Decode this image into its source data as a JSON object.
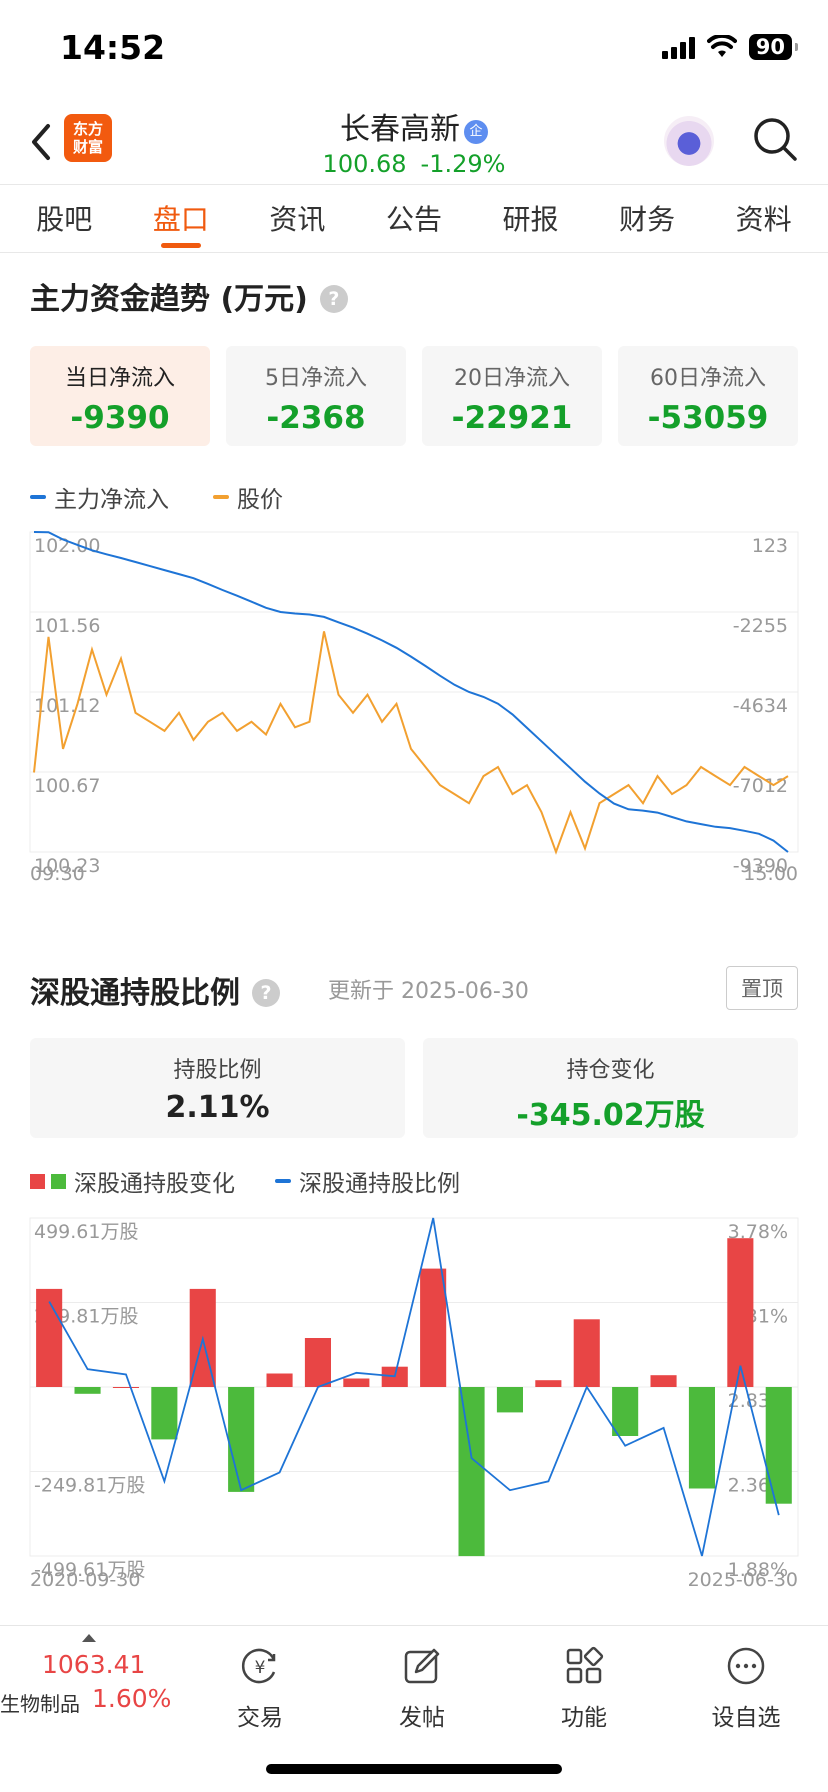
{
  "status": {
    "time": "14:52",
    "battery": "90"
  },
  "header": {
    "logo_line1": "东方",
    "logo_line2": "财富",
    "stock_name": "长春高新",
    "badge": "企",
    "price": "100.68",
    "change": "-1.29%"
  },
  "tabs": [
    "股吧",
    "盘口",
    "资讯",
    "公告",
    "研报",
    "财务",
    "资料"
  ],
  "active_tab": "盘口",
  "fund_flow": {
    "title": "主力资金趋势 (万元)",
    "help": "?",
    "cards": [
      {
        "label": "当日净流入",
        "value": "-9390"
      },
      {
        "label": "5日净流入",
        "value": "-2368"
      },
      {
        "label": "20日净流入",
        "value": "-22921"
      },
      {
        "label": "60日净流入",
        "value": "-53059"
      }
    ],
    "legend": {
      "main": "主力净流入",
      "price": "股价"
    }
  },
  "holding": {
    "title": "深股通持股比例",
    "help": "?",
    "updated": "更新于 2025-06-30",
    "top_button": "置顶",
    "ratio_label": "持股比例",
    "ratio_value": "2.11%",
    "change_label": "持仓变化",
    "change_value": "-345.02万股",
    "legend": {
      "change": "深股通持股变化",
      "ratio": "深股通持股比例"
    }
  },
  "bottom_bar": {
    "index_value": "1063.41",
    "index_name": "生物制品",
    "index_change": "1.60%",
    "items": [
      "交易",
      "发帖",
      "功能",
      "设自选"
    ]
  },
  "colors": {
    "up": "#e84545",
    "down": "#14a02a",
    "flow_line": "#1e74d6",
    "price_line": "#f2a030",
    "accent": "#f05a0f"
  },
  "chart_data": [
    {
      "type": "line",
      "x_start": "09:30",
      "x_end": "15:00",
      "left_axis_ticks": [
        "102.00",
        "101.56",
        "101.12",
        "100.67",
        "100.23"
      ],
      "right_axis_ticks": [
        "123",
        "-2255",
        "-4634",
        "-7012",
        "-9390"
      ],
      "ylim_price": [
        100.23,
        102.0
      ],
      "ylim_flow": [
        -9390,
        123
      ],
      "grid": true,
      "series": [
        {
          "name": "主力净流入",
          "axis": "right",
          "values": [
            123,
            118,
            -100,
            -260,
            -420,
            -540,
            -650,
            -770,
            -890,
            -1010,
            -1130,
            -1250,
            -1420,
            -1600,
            -1770,
            -1950,
            -2130,
            -2255,
            -2300,
            -2330,
            -2400,
            -2560,
            -2720,
            -2900,
            -3100,
            -3320,
            -3580,
            -3860,
            -4150,
            -4420,
            -4634,
            -4780,
            -4980,
            -5300,
            -5700,
            -6100,
            -6500,
            -6900,
            -7300,
            -7650,
            -7950,
            -8120,
            -8160,
            -8220,
            -8350,
            -8480,
            -8560,
            -8640,
            -8680,
            -8760,
            -8850,
            -9050,
            -9390
          ]
        },
        {
          "name": "股价",
          "axis": "left",
          "values": [
            100.67,
            101.42,
            100.8,
            101.05,
            101.35,
            101.1,
            101.3,
            101.0,
            100.95,
            100.9,
            101.0,
            100.85,
            100.95,
            101.0,
            100.9,
            100.95,
            100.88,
            101.05,
            100.92,
            100.95,
            101.45,
            101.1,
            101.0,
            101.1,
            100.95,
            101.05,
            100.8,
            100.7,
            100.6,
            100.55,
            100.5,
            100.65,
            100.7,
            100.55,
            100.6,
            100.45,
            100.23,
            100.45,
            100.25,
            100.5,
            100.55,
            100.6,
            100.5,
            100.65,
            100.55,
            100.6,
            100.7,
            100.65,
            100.6,
            100.7,
            100.65,
            100.6,
            100.65
          ]
        }
      ]
    },
    {
      "type": "bar",
      "x_start": "2020-09-30",
      "x_end": "2025-06-30",
      "left_axis_ticks": [
        "499.61万股",
        "249.81万股",
        "-249.81万股",
        "-499.61万股"
      ],
      "right_axis_ticks": [
        "3.78%",
        "3.31%",
        "2.83%",
        "2.36%",
        "1.88%"
      ],
      "ylim_change": [
        -499.61,
        499.61
      ],
      "ylim_ratio": [
        1.88,
        3.78
      ],
      "grid": true,
      "series": [
        {
          "name": "深股通持股变化",
          "axis": "left",
          "values": [
            290,
            -20,
            0,
            -155,
            290,
            -310,
            40,
            145,
            25,
            60,
            350,
            -500,
            -75,
            20,
            200,
            -145,
            35,
            -300,
            440,
            -345
          ]
        },
        {
          "name": "深股通持股比例",
          "axis": "right",
          "values": [
            3.31,
            2.93,
            2.9,
            2.3,
            3.1,
            2.25,
            2.35,
            2.83,
            2.91,
            2.89,
            3.78,
            2.43,
            2.25,
            2.3,
            2.83,
            2.5,
            2.6,
            1.88,
            2.95,
            2.11
          ]
        }
      ]
    }
  ]
}
